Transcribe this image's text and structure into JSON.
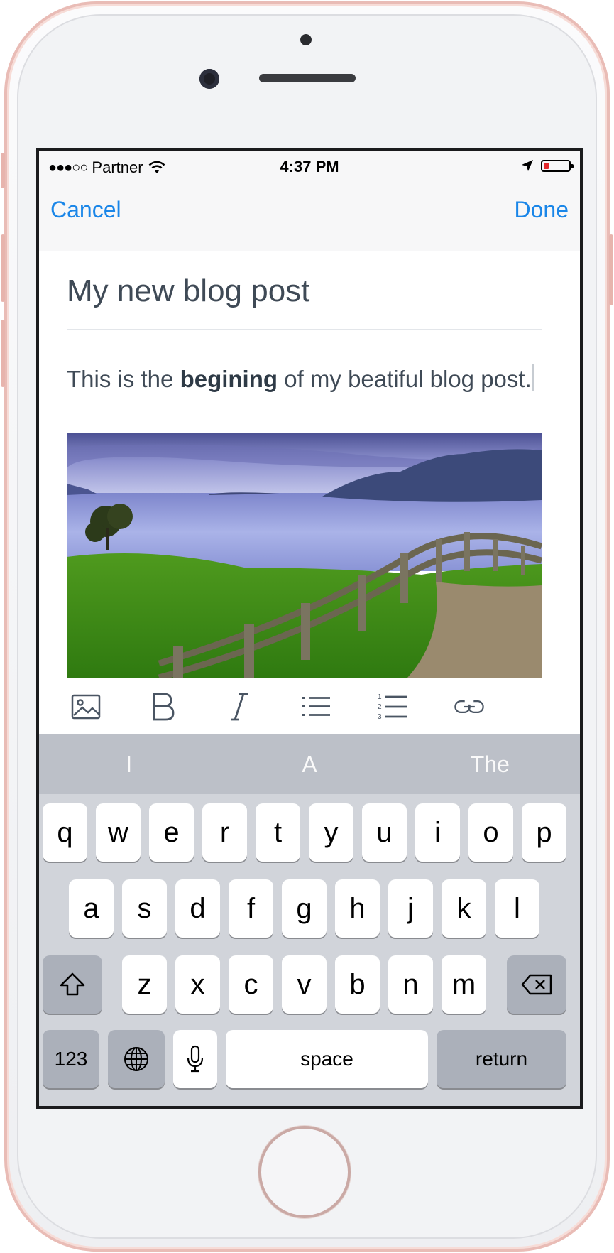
{
  "status_bar": {
    "signal": "●●●○○",
    "carrier": "Partner",
    "time": "4:37 PM"
  },
  "nav": {
    "cancel_label": "Cancel",
    "done_label": "Done"
  },
  "editor": {
    "title": "My new blog post",
    "body_before": "This is the ",
    "body_bold": "begining",
    "body_after": " of my beatiful blog post."
  },
  "format_toolbar": {
    "icons": [
      "image-icon",
      "bold-icon",
      "italic-icon",
      "bulleted-list-icon",
      "numbered-list-icon",
      "link-icon"
    ]
  },
  "keyboard": {
    "suggestions": [
      "I",
      "A",
      "The"
    ],
    "row1": [
      "q",
      "w",
      "e",
      "r",
      "t",
      "y",
      "u",
      "i",
      "o",
      "p"
    ],
    "row2": [
      "a",
      "s",
      "d",
      "f",
      "g",
      "h",
      "j",
      "k",
      "l"
    ],
    "row3": [
      "z",
      "x",
      "c",
      "v",
      "b",
      "n",
      "m"
    ],
    "numbers_label": "123",
    "space_label": "space",
    "return_label": "return"
  },
  "colors": {
    "accent": "#1a86e8",
    "text": "#3f4a56",
    "keyboard_bg": "#d1d4da",
    "phone_frame": "#e9bcb6"
  }
}
